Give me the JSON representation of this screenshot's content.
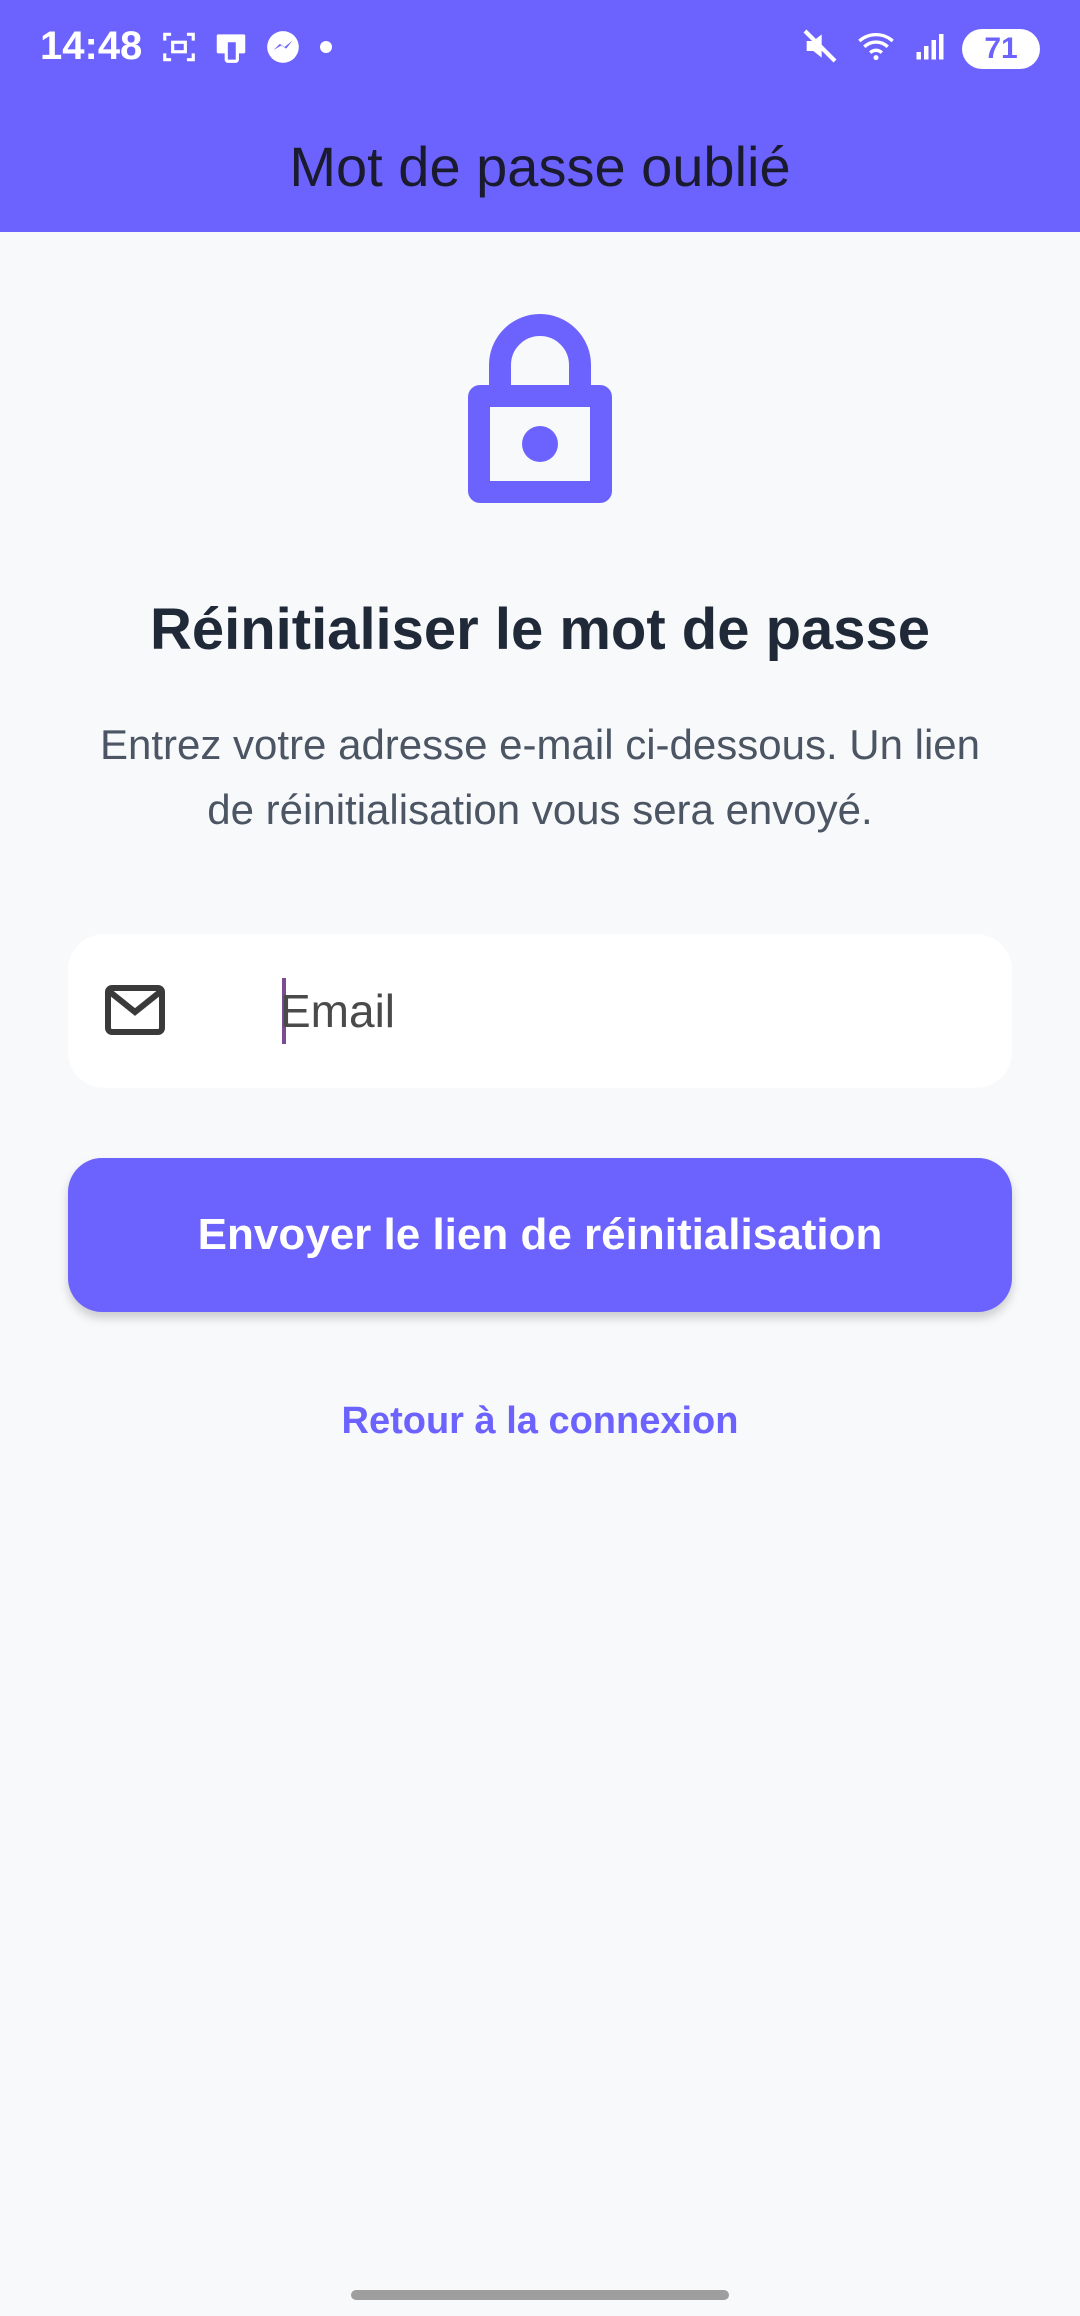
{
  "status_bar": {
    "time": "14:48",
    "battery": "71"
  },
  "app_bar": {
    "title": "Mot de passe oublié"
  },
  "content": {
    "title": "Réinitialiser le mot de passe",
    "subtitle": "Entrez votre adresse e-mail ci-dessous. Un lien de réinitialisation vous sera envoyé.",
    "email_field": {
      "placeholder": "Email",
      "value": ""
    },
    "send_button_label": "Envoyer le lien de réinitialisation",
    "back_link_label": "Retour à la connexion"
  },
  "icons": {
    "lock": "lock-icon",
    "email": "mail-icon"
  },
  "colors": {
    "primary": "#6C63FF",
    "background": "#F8F9FB",
    "title_text": "#1F2937",
    "subtitle_text": "#4B5563"
  }
}
